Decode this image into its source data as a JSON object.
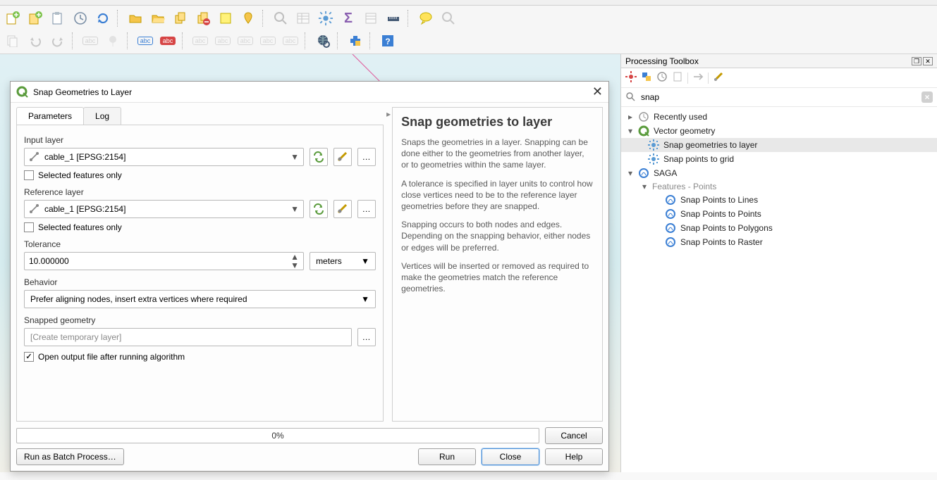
{
  "dialog": {
    "title": "Snap Geometries to Layer",
    "tabs": {
      "parameters": "Parameters",
      "log": "Log"
    },
    "labels": {
      "input_layer": "Input layer",
      "selected_only": "Selected features only",
      "reference_layer": "Reference layer",
      "tolerance": "Tolerance",
      "behavior": "Behavior",
      "snapped_geometry": "Snapped geometry",
      "open_output": "Open output file after running algorithm"
    },
    "values": {
      "input_layer": "cable_1 [EPSG:2154]",
      "reference_layer": "cable_1 [EPSG:2154]",
      "tolerance": "10.000000",
      "tolerance_unit": "meters",
      "behavior": "Prefer aligning nodes, insert extra vertices where required",
      "snapped_placeholder": "[Create temporary layer]"
    },
    "progress": "0%",
    "buttons": {
      "cancel": "Cancel",
      "batch": "Run as Batch Process…",
      "run": "Run",
      "close": "Close",
      "help": "Help"
    },
    "help": {
      "title": "Snap geometries to layer",
      "p1": "Snaps the geometries in a layer. Snapping can be done either to the geometries from another layer, or to geometries within the same layer.",
      "p2": "A tolerance is specified in layer units to control how close vertices need to be to the reference layer geometries before they are snapped.",
      "p3": "Snapping occurs to both nodes and edges. Depending on the snapping behavior, either nodes or edges will be preferred.",
      "p4": "Vertices will be inserted or removed as required to make the geometries match the reference geometries."
    }
  },
  "toolbox": {
    "title": "Processing Toolbox",
    "search": "snap",
    "recently_used": "Recently used",
    "vector_geometry": "Vector geometry",
    "snap_to_layer": "Snap geometries to layer",
    "snap_to_grid": "Snap points to grid",
    "saga": "SAGA",
    "features_points": "Features - Points",
    "sp_lines": "Snap Points to Lines",
    "sp_points": "Snap Points to Points",
    "sp_polygons": "Snap Points to Polygons",
    "sp_raster": "Snap Points to Raster"
  }
}
